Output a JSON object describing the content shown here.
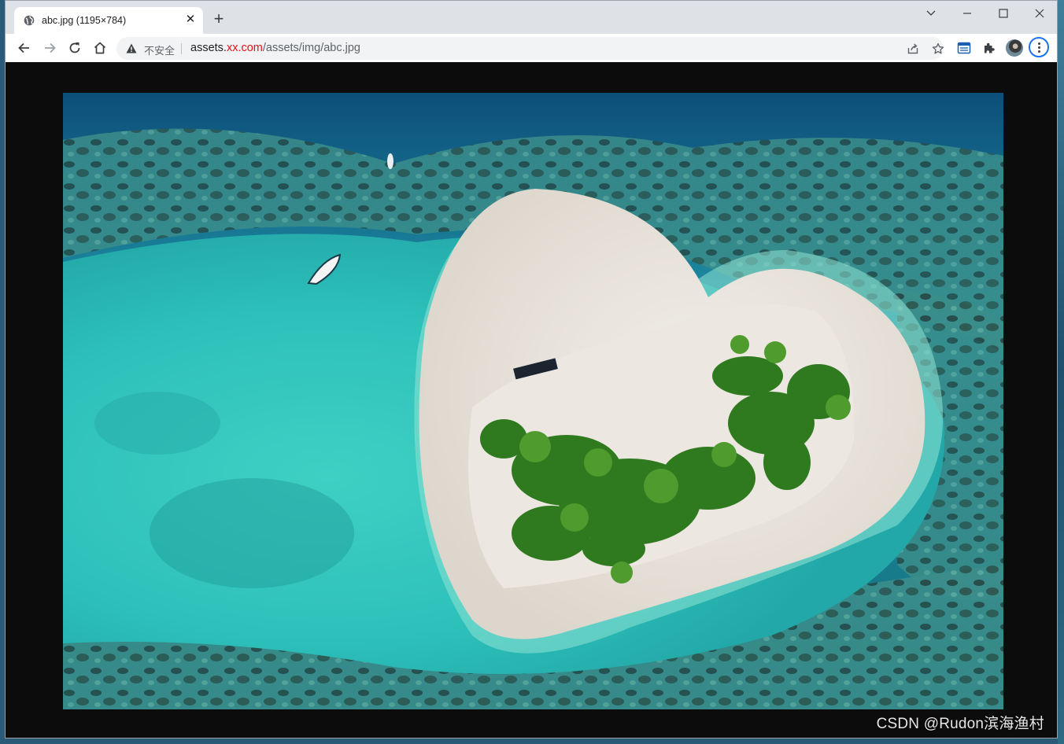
{
  "tab": {
    "title": "abc.jpg (1195×784)",
    "close_glyph": "✕"
  },
  "new_tab_glyph": "+",
  "window_controls": [
    "chevron-down-icon",
    "minimize-icon",
    "maximize-icon",
    "close-icon"
  ],
  "address_bar": {
    "security_label": "不安全",
    "url_prefix": "assets.",
    "url_domain_masked": "xx.com",
    "url_path": "/assets/img/abc.jpg"
  },
  "image": {
    "description_icon": "heart-shaped-island-photo"
  },
  "watermark": "CSDN @Rudon滨海渔村",
  "colors": {
    "accent": "#1a73e8",
    "domain_highlight": "#e8121a",
    "viewer_background": "#0c0c0c"
  }
}
